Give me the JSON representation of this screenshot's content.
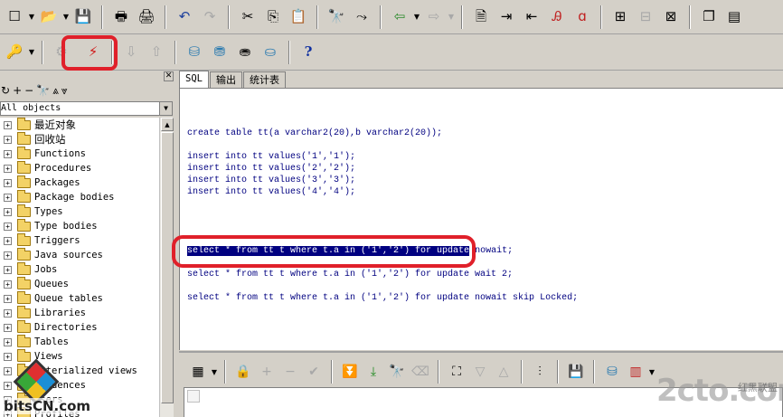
{
  "toolbar1": {
    "icons": [
      "new-icon",
      "open-icon",
      "save-icon",
      "print-icon",
      "print-preview-icon",
      "undo-icon",
      "redo-icon",
      "cut-icon",
      "copy-icon",
      "paste-icon",
      "find-icon",
      "find-next-icon",
      "back-icon",
      "forward-icon",
      "execute-script-icon",
      "indent-icon",
      "unindent-icon",
      "uppercase-icon",
      "lowercase-icon",
      "comment-icon",
      "uncomment-icon",
      "window-list-icon"
    ]
  },
  "toolbar2": {
    "icons": [
      "key-icon",
      "lightning-icon",
      "commit-icon",
      "rollback-icon",
      "sql-execute-icon",
      "sql-window-icon",
      "command-window-icon",
      "explain-plan-icon"
    ],
    "help_glyph": "?"
  },
  "left_panel": {
    "filter_value": "All objects",
    "tree_items": [
      "最近对象",
      "回收站",
      "Functions",
      "Procedures",
      "Packages",
      "Package bodies",
      "Types",
      "Type bodies",
      "Triggers",
      "Java sources",
      "Jobs",
      "Queues",
      "Queue tables",
      "Libraries",
      "Directories",
      "Tables",
      "Views",
      "Materialized views",
      "Sequences",
      "Users",
      "Profiles"
    ]
  },
  "tabs": [
    {
      "label": "SQL",
      "active": true
    },
    {
      "label": "输出",
      "active": false
    },
    {
      "label": "统计表",
      "active": false
    }
  ],
  "editor": {
    "create_line": "create table tt(a varchar2(20),b varchar2(20));",
    "insert_lines": [
      "insert into tt values('1','1');",
      "insert into tt values('2','2');",
      "insert into tt values('3','3');",
      "insert into tt values('4','4');"
    ],
    "select1_selected": "select * from tt t where t.a in ('1','2') for update",
    "select1_rest": " nowait;",
    "select2": "select * from tt t where t.a in ('1','2') for update wait 2;",
    "select3": "select * from tt t where t.a in ('1','2') for update nowait skip Locked;"
  },
  "watermarks": {
    "left": "bitsCN.com",
    "right_big": "2cto.com",
    "right_cjk": "红黑联盟"
  },
  "colors": {
    "highlight": "#000080",
    "keyword": "#000080",
    "annotation_red": "#e0202a",
    "chrome": "#d4d0c8"
  }
}
